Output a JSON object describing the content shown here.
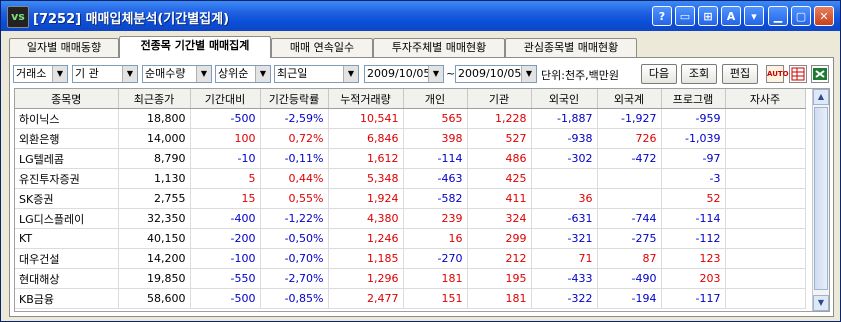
{
  "window": {
    "logo": "vs",
    "title": "[7252] 매매입체분석(기간별집계)",
    "buttons": [
      "?",
      "▭",
      "⊞",
      "A",
      "▾",
      "▁",
      "▢",
      "✕"
    ]
  },
  "tabs": [
    {
      "label": "일자별 매매동향",
      "active": false
    },
    {
      "label": "전종목 기간별 매매집계",
      "active": true
    },
    {
      "label": "매매 연속일수",
      "active": false
    },
    {
      "label": "투자주체별 매매현황",
      "active": false
    },
    {
      "label": "관심종목별 매매현황",
      "active": false
    }
  ],
  "toolbar": {
    "market": "거래소",
    "investor": "기 관",
    "sort_by": "순매수량",
    "order": "상위순",
    "period": "최근일",
    "date_from": "2009/10/05",
    "tilde": "~",
    "date_to": "2009/10/05",
    "unit": "단위:천주,백만원",
    "next_label": "다음",
    "query_label": "조회",
    "edit_label": "편집",
    "auto_label": "AUTO"
  },
  "table": {
    "headers": [
      "종목명",
      "최근종가",
      "기간대비",
      "기간등락률",
      "누적거래량",
      "개인",
      "기관",
      "외국인",
      "외국계",
      "프로그램",
      "자사주"
    ],
    "rows": [
      [
        "하이닉스",
        "18,800",
        "-500",
        "-2,59%",
        "10,541",
        "565",
        "1,228",
        "-1,887",
        "-1,927",
        "-959",
        ""
      ],
      [
        "외환은행",
        "14,000",
        "100",
        "0,72%",
        "6,846",
        "398",
        "527",
        "-938",
        "726",
        "-1,039",
        ""
      ],
      [
        "LG텔레콤",
        "8,790",
        "-10",
        "-0,11%",
        "1,612",
        "-114",
        "486",
        "-302",
        "-472",
        "-97",
        ""
      ],
      [
        "유진투자증권",
        "1,130",
        "5",
        "0,44%",
        "5,348",
        "-463",
        "425",
        "",
        "",
        "-3",
        ""
      ],
      [
        "SK증권",
        "2,755",
        "15",
        "0,55%",
        "1,924",
        "-582",
        "411",
        "36",
        "",
        "52",
        ""
      ],
      [
        "LG디스플레이",
        "32,350",
        "-400",
        "-1,22%",
        "4,380",
        "239",
        "324",
        "-631",
        "-744",
        "-114",
        ""
      ],
      [
        "KT",
        "40,150",
        "-200",
        "-0,50%",
        "1,246",
        "16",
        "299",
        "-321",
        "-275",
        "-112",
        ""
      ],
      [
        "대우건설",
        "14,200",
        "-100",
        "-0,70%",
        "1,185",
        "-270",
        "212",
        "71",
        "87",
        "123",
        ""
      ],
      [
        "현대해상",
        "19,850",
        "-550",
        "-2,70%",
        "1,296",
        "181",
        "195",
        "-433",
        "-490",
        "203",
        ""
      ],
      [
        "KB금융",
        "58,600",
        "-500",
        "-0,85%",
        "2,477",
        "151",
        "181",
        "-322",
        "-194",
        "-117",
        ""
      ]
    ]
  },
  "colors": {
    "negative": "#0000c8",
    "positive": "#e00000",
    "title_bar": "#1f5fe0"
  }
}
